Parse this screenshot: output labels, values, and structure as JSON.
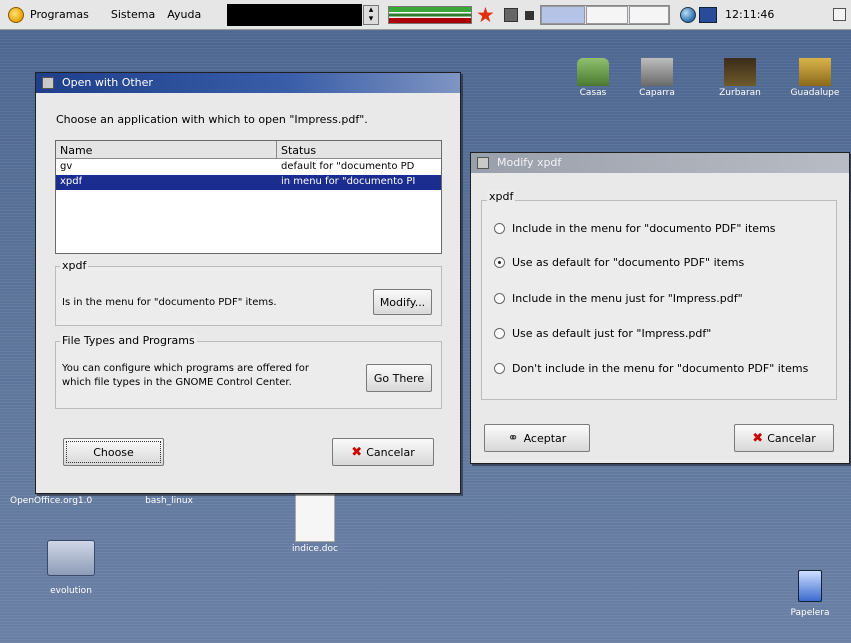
{
  "panel": {
    "menus": [
      "Programas",
      "Sistema",
      "Ayuda"
    ],
    "clock": "12:11:46"
  },
  "desktop": {
    "icons": [
      {
        "label": "Casas",
        "sub": ""
      },
      {
        "label": "Caparra",
        "sub": ""
      },
      {
        "label": "Zurbaran",
        "sub": ""
      },
      {
        "label": "Guadalupe",
        "sub": ""
      },
      {
        "label": "OpenOffice.org1.0",
        "sub": ""
      },
      {
        "label": "bash_linux",
        "sub": ""
      },
      {
        "label": "indice.doc",
        "sub": ""
      },
      {
        "label": "evolution",
        "sub": ""
      },
      {
        "label": "Papelera",
        "sub": ""
      }
    ]
  },
  "open_with": {
    "title": "Open with Other",
    "prompt": "Choose an application with which to open \"Impress.pdf\".",
    "columns": [
      "Name",
      "Status"
    ],
    "rows": [
      {
        "name": "gv",
        "status": "default for \"documento PD",
        "selected": false
      },
      {
        "name": "xpdf",
        "status": "in menu for \"documento PI",
        "selected": true
      }
    ],
    "app_frame_label": "xpdf",
    "app_status": "Is in the menu for \"documento PDF\" items.",
    "modify_label": "Modify...",
    "filetypes_label": "File Types and Programs",
    "filetypes_text_1": "You can configure which programs are offered for",
    "filetypes_text_2": "which file types in the GNOME Control Center.",
    "go_there_label": "Go There",
    "choose_label": "Choose",
    "cancel_label": "Cancelar"
  },
  "modify": {
    "title": "Modify xpdf",
    "frame_label": "xpdf",
    "options": [
      {
        "label": "Include in the menu for \"documento PDF\" items",
        "checked": false
      },
      {
        "label": "Use as default for \"documento PDF\" items",
        "checked": true
      },
      {
        "label": "Include in the menu just for \"Impress.pdf\"",
        "checked": false
      },
      {
        "label": "Use as default just for \"Impress.pdf\"",
        "checked": false
      },
      {
        "label": "Don't include in the menu for \"documento PDF\" items",
        "checked": false
      }
    ],
    "ok_label": "Aceptar",
    "cancel_label": "Cancelar"
  }
}
